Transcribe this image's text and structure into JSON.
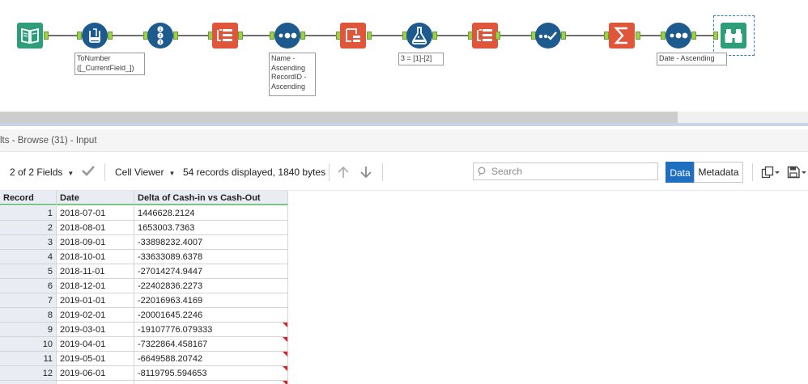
{
  "workflow": {
    "tools": [
      {
        "name": "input-data-tool",
        "icon": "book-icon",
        "color": "#2e9e7a"
      },
      {
        "name": "multi-field-formula-tool",
        "icon": "beaker-multi-icon",
        "color": "#1d5b8f"
      },
      {
        "name": "record-id-tool",
        "icon": "record-id-icon",
        "color": "#1d5b8f"
      },
      {
        "name": "cross-tab-tool",
        "icon": "crosstab-icon",
        "color": "#e0563b"
      },
      {
        "name": "sort-tool",
        "icon": "sort-dots-icon",
        "color": "#1d5b8f"
      },
      {
        "name": "transpose-tool",
        "icon": "transpose-icon",
        "color": "#e0563b"
      },
      {
        "name": "formula-tool",
        "icon": "flask-icon",
        "color": "#1d5b8f"
      },
      {
        "name": "cross-tab-tool-2",
        "icon": "crosstab-icon",
        "color": "#e0563b"
      },
      {
        "name": "select-tool",
        "icon": "check-dots-icon",
        "color": "#1d5b8f"
      },
      {
        "name": "summarize-tool",
        "icon": "sigma-icon",
        "color": "#e0563b"
      },
      {
        "name": "sort-tool-2",
        "icon": "sort-dots-icon",
        "color": "#1d5b8f"
      },
      {
        "name": "browse-tool",
        "icon": "binoculars-icon",
        "color": "#2e9e7a"
      }
    ],
    "annotations": {
      "multi_field_formula": [
        "ToNumber",
        "([_CurrentField_])"
      ],
      "sort": [
        "Name -",
        "Ascending",
        "RecordID -",
        "Ascending"
      ],
      "formula": [
        "3 = [1]-[2]"
      ],
      "sort_2": [
        "Date - Ascending"
      ]
    }
  },
  "results": {
    "title": "lts - Browse (31) - Input",
    "fields_label": "2 of 2 Fields",
    "viewer_label": "Cell Viewer",
    "status": "54 records displayed, 1840 bytes",
    "search_placeholder": "Search",
    "data_button": "Data",
    "metadata_button": "Metadata"
  },
  "grid": {
    "columns": [
      "Record",
      "Date",
      "Delta of Cash-in vs Cash-Out"
    ],
    "rows": [
      {
        "record": "1",
        "date": "2018-07-01",
        "delta": "1446628.2124",
        "flag": false
      },
      {
        "record": "2",
        "date": "2018-08-01",
        "delta": "1653003.7363",
        "flag": false
      },
      {
        "record": "3",
        "date": "2018-09-01",
        "delta": "-33898232.4007",
        "flag": false
      },
      {
        "record": "4",
        "date": "2018-10-01",
        "delta": "-33633089.6378",
        "flag": false
      },
      {
        "record": "5",
        "date": "2018-11-01",
        "delta": "-27014274.9447",
        "flag": false
      },
      {
        "record": "6",
        "date": "2018-12-01",
        "delta": "-22402836.2273",
        "flag": false
      },
      {
        "record": "7",
        "date": "2019-01-01",
        "delta": "-22016963.4169",
        "flag": false
      },
      {
        "record": "8",
        "date": "2019-02-01",
        "delta": "-20001645.2246",
        "flag": false
      },
      {
        "record": "9",
        "date": "2019-03-01",
        "delta": "-19107776.079333",
        "flag": true
      },
      {
        "record": "10",
        "date": "2019-04-01",
        "delta": "-7322864.458167",
        "flag": true
      },
      {
        "record": "11",
        "date": "2019-05-01",
        "delta": "-6649588.20742",
        "flag": true
      },
      {
        "record": "12",
        "date": "2019-06-01",
        "delta": "-8119795.594653",
        "flag": true
      },
      {
        "record": "",
        "date": "",
        "delta": "",
        "flag": true
      }
    ]
  }
}
